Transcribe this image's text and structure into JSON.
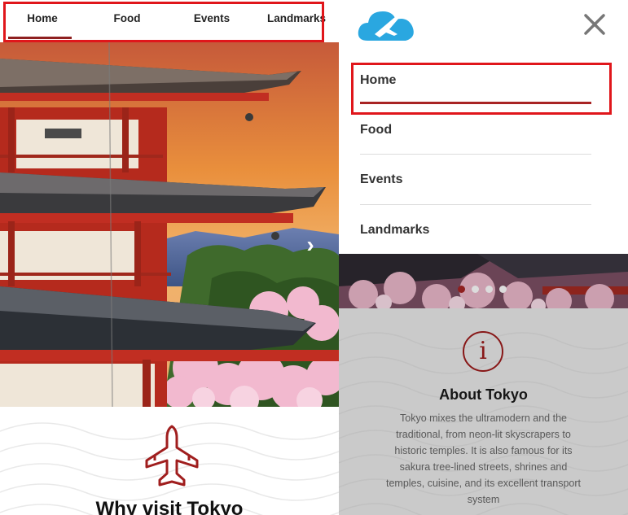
{
  "top_nav": {
    "items": [
      {
        "label": "Home",
        "active": true
      },
      {
        "label": "Food",
        "active": false
      },
      {
        "label": "Events",
        "active": false
      },
      {
        "label": "Landmarks",
        "active": false
      }
    ]
  },
  "hero": {
    "next_arrow": "›"
  },
  "why_section": {
    "icon": "airplane-icon",
    "title": "Why visit Tokyo"
  },
  "side_menu": {
    "logo_icon": "cloud-plane-logo",
    "close_icon": "close-icon",
    "items": [
      {
        "label": "Home",
        "active": true
      },
      {
        "label": "Food",
        "active": false
      },
      {
        "label": "Events",
        "active": false
      },
      {
        "label": "Landmarks",
        "active": false
      }
    ]
  },
  "carousel": {
    "dots": 4,
    "active_dot": 0
  },
  "about": {
    "icon": "info-icon",
    "icon_glyph": "i",
    "title": "About Tokyo",
    "text": "Tokyo mixes the ultramodern and the traditional, from neon-lit skyscrapers to historic temples. It is also famous for its sakura tree-lined streets, shrines and temples, cuisine, and its excellent transport system"
  },
  "colors": {
    "accent": "#8e1f1f",
    "highlight_box": "#e0161b",
    "logo_blue": "#2aa7e0"
  }
}
